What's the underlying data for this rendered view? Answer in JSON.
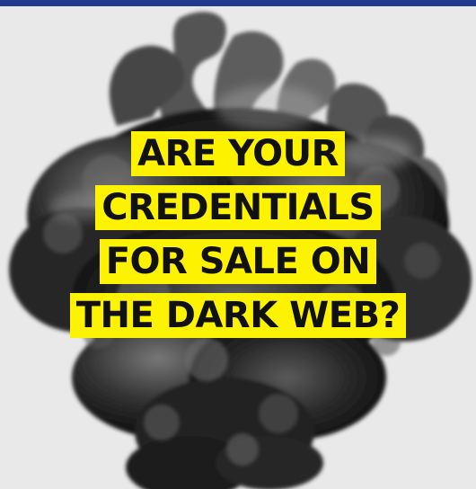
{
  "colors": {
    "background": "#e9e9e9",
    "top_bar": "#203b8c",
    "highlight": "#fdf200",
    "text": "#111111"
  },
  "headline": {
    "lines": [
      "ARE YOUR",
      "CREDENTIALS",
      "FOR SALE ON",
      "THE DARK WEB?"
    ]
  }
}
